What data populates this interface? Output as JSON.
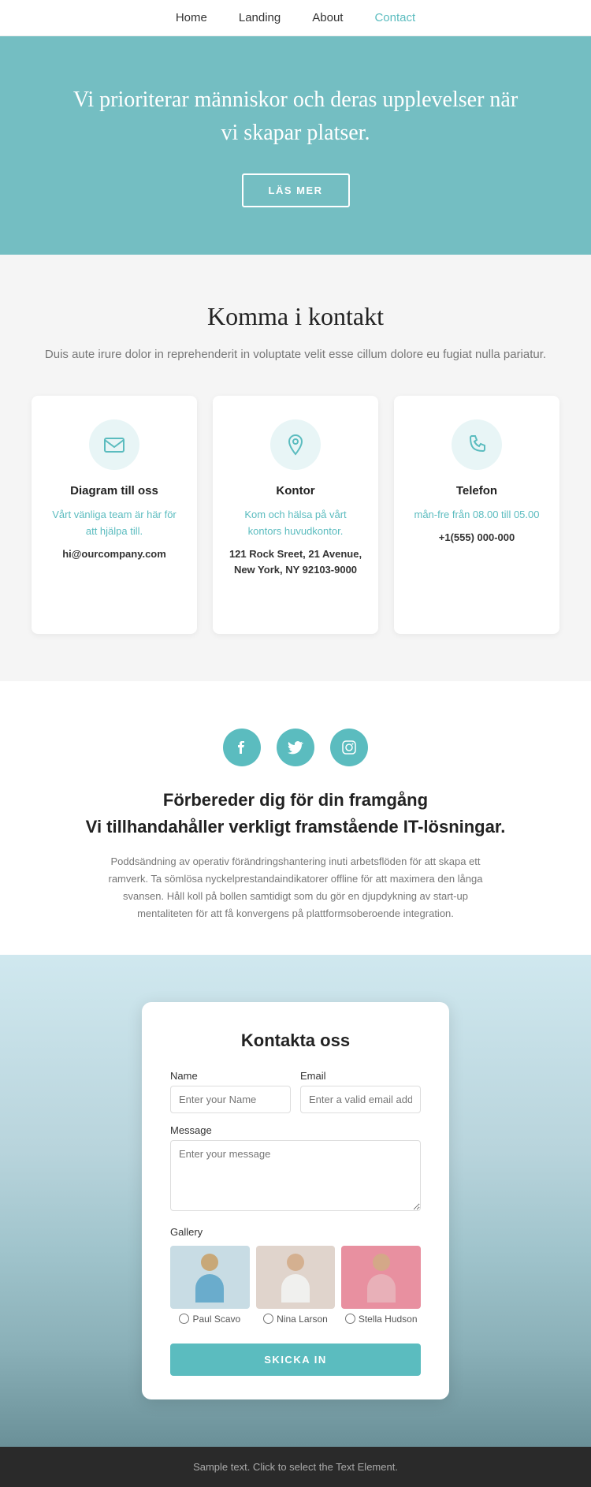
{
  "nav": {
    "items": [
      {
        "label": "Home",
        "active": false
      },
      {
        "label": "Landing",
        "active": false
      },
      {
        "label": "About",
        "active": false
      },
      {
        "label": "Contact",
        "active": true
      }
    ]
  },
  "hero": {
    "heading": "Vi prioriterar människor och deras upplevelser när vi skapar platser.",
    "button_label": "LÄS MER"
  },
  "contact_section": {
    "heading": "Komma i kontakt",
    "description": "Duis aute irure dolor in reprehenderit in voluptate velit esse cillum dolore eu fugiat nulla pariatur.",
    "cards": [
      {
        "title": "Diagram till oss",
        "link_text": "Vårt vänliga team är här för att hjälpa till.",
        "info": "hi@ourcompany.com",
        "icon": "email"
      },
      {
        "title": "Kontor",
        "link_text": "Kom och hälsa på vårt kontors huvudkontor.",
        "info": "121 Rock Sreet, 21 Avenue,\nNew York, NY 92103-9000",
        "icon": "location"
      },
      {
        "title": "Telefon",
        "link_text": "mån-fre från 08.00 till 05.00",
        "info": "+1(555) 000-000",
        "icon": "phone"
      }
    ]
  },
  "social_section": {
    "heading1": "Förbereder dig för din framgång",
    "heading2": "Vi tillhandahåller verkligt framstående IT-lösningar.",
    "description": "Poddsändning av operativ förändringshantering inuti arbetsflöden för att skapa ett ramverk. Ta sömlösa nyckelprestandaindikatorer offline för att maximera den långa svansen. Håll koll på bollen samtidigt som du gör en djupdykning av start-up mentaliteten för att få konvergens på plattformsoberoende integration.",
    "icons": [
      {
        "name": "facebook-icon",
        "symbol": "f"
      },
      {
        "name": "twitter-icon",
        "symbol": "t"
      },
      {
        "name": "instagram-icon",
        "symbol": "i"
      }
    ]
  },
  "form_section": {
    "heading": "Kontakta oss",
    "name_label": "Name",
    "name_placeholder": "Enter your Name",
    "email_label": "Email",
    "email_placeholder": "Enter a valid email address",
    "message_label": "Message",
    "message_placeholder": "Enter your message",
    "gallery_label": "Gallery",
    "gallery_items": [
      {
        "name": "Paul Scavo"
      },
      {
        "name": "Nina Larson"
      },
      {
        "name": "Stella Hudson"
      }
    ],
    "submit_label": "SKICKA IN"
  },
  "footer": {
    "text": "Sample text. Click to select the Text Element."
  }
}
